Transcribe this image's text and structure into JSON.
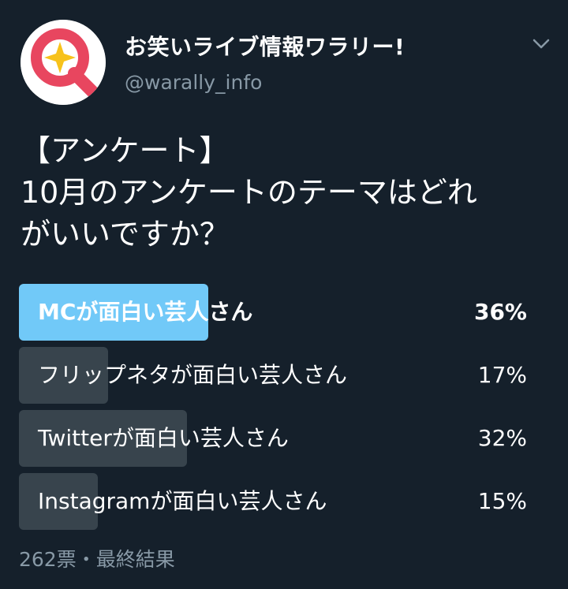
{
  "account": {
    "display_name": "お笑いライブ情報ワラリー!",
    "handle": "@warally_info",
    "avatar_icon": "warally-logo-icon"
  },
  "menu_icon": "chevron-down-icon",
  "tweet": {
    "lines": [
      "【アンケート】",
      "10月のアンケートのテーマはどれ",
      "がいいですか？"
    ]
  },
  "poll": {
    "options": [
      {
        "label": "MCが面白い芸人さん",
        "percent_text": "36%",
        "percent": 36,
        "winner": true
      },
      {
        "label": "フリップネタが面白い芸人さん",
        "percent_text": "17%",
        "percent": 17,
        "winner": false
      },
      {
        "label": "Twitterが面白い芸人さん",
        "percent_text": "32%",
        "percent": 32,
        "winner": false
      },
      {
        "label": "Instagramが面白い芸人さん",
        "percent_text": "15%",
        "percent": 15,
        "winner": false
      }
    ],
    "footer": "262票・最終結果"
  },
  "colors": {
    "background": "#15202b",
    "winner_bar": "#71c9f8",
    "bar": "#38444d",
    "secondary_text": "#8899a6",
    "logo_red": "#e8465f",
    "logo_star": "#f7c21b"
  }
}
